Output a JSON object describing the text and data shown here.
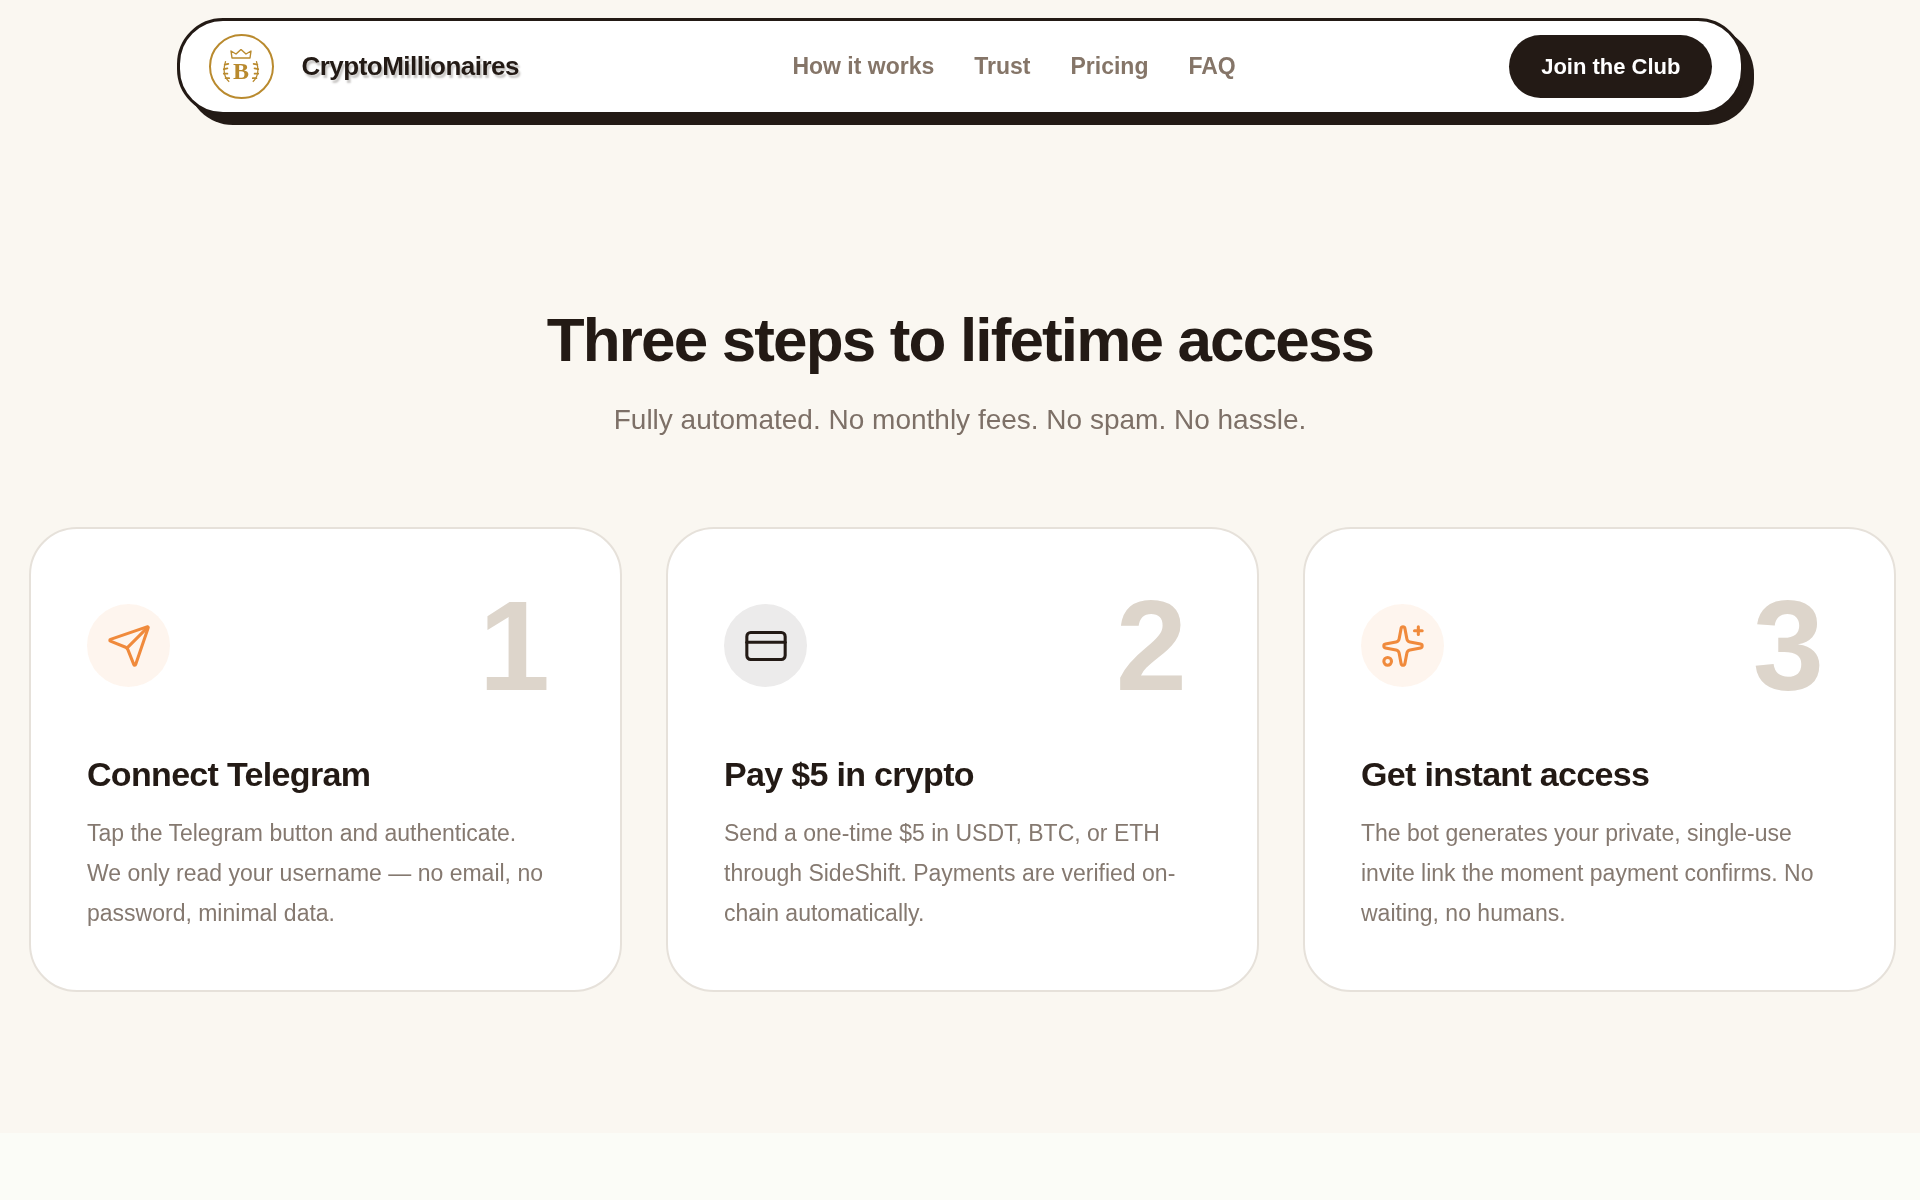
{
  "nav": {
    "logo_letter": "B",
    "brand": "CryptoMillionaires",
    "links": [
      "How it works",
      "Trust",
      "Pricing",
      "FAQ"
    ],
    "cta": "Join the Club"
  },
  "section": {
    "title": "Three steps to lifetime access",
    "subtitle": "Fully automated. No monthly fees. No spam. No hassle."
  },
  "steps": [
    {
      "number": "1",
      "title": "Connect Telegram",
      "text": "Tap the Telegram button and authenticate. We only read your username — no email, no password, minimal data.",
      "color": "#f08a3c"
    },
    {
      "number": "2",
      "title": "Pay $5 in crypto",
      "text": "Send a one-time $5 in USDT, BTC, or ETH through SideShift. Payments are verified on-chain automatically.",
      "color": "#231a15"
    },
    {
      "number": "3",
      "title": "Get instant access",
      "text": "The bot generates your private, single-use invite link the moment payment confirms. No waiting, no humans.",
      "color": "#f08a3c"
    }
  ]
}
